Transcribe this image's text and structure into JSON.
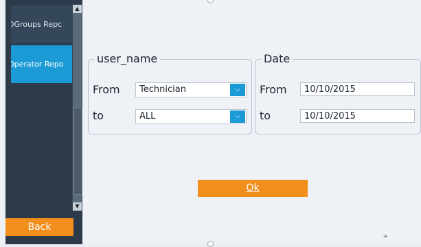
{
  "sidebar": {
    "items": [
      {
        "label": "DGroups Repc"
      },
      {
        "label": "Operator Repo"
      }
    ],
    "back_label": "Back"
  },
  "user_group": {
    "legend": "user_name",
    "from_label": "From",
    "from_value": "Technician",
    "to_label": "to",
    "to_value": "ALL"
  },
  "date_group": {
    "legend": "Date",
    "from_label": "From",
    "from_value": "10/10/2015",
    "to_label": "to",
    "to_value": "10/10/2015"
  },
  "ok_label": "Ok",
  "colors": {
    "accent": "#f28e1b",
    "selected": "#1b9ad6",
    "sidebar": "#2d3a4a"
  }
}
